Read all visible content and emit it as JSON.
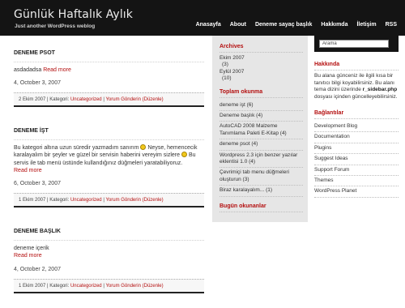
{
  "header": {
    "title": "Günlük Haftalık Aylık",
    "description": "Just another WordPress weblog",
    "nav": [
      "Anasayfa",
      "About",
      "Deneme sayaç başlık",
      "Hakkımda",
      "İletişim",
      "RSS"
    ]
  },
  "posts": [
    {
      "title": "DENEME PSOT",
      "text": "asdadadsa",
      "more": "Read more",
      "date": "4, October 3, 2007",
      "meta_date": "2 Ekim 2007",
      "meta_cat_label": "Kategori:",
      "meta_cat": "Uncategorized",
      "meta_comment": "Yorum Gönderin",
      "meta_edit": "(Düzenle)"
    },
    {
      "title": "DENEME İŞT",
      "text_a": "Bu kategori altına uzun süredir yazmadım sanırım",
      "text_b": "Neyse, hemencecik karalayalım bir şeyler ve güzel bir servisin haberini vereyim sizlere",
      "text_c": "Bu servis ile tab menü üstünde kullandığınız düğmeleri yaratabiliyoruz.",
      "more": "Read more",
      "date": "6, October 3, 2007",
      "meta_date": "1 Ekim 2007",
      "meta_cat_label": "Kategori:",
      "meta_cat": "Uncategorized",
      "meta_comment": "Yorum Gönderin",
      "meta_edit": "(Düzenle)"
    },
    {
      "title": "DENEME BAŞLIK",
      "text": "deneme içerik",
      "more": "Read more",
      "date": "4, October 2, 2007",
      "meta_date": "1 Ekim 2007",
      "meta_cat_label": "Kategori:",
      "meta_cat": "Uncategorized",
      "meta_comment": "Yorum Gönderin",
      "meta_edit": "(Düzenle)"
    }
  ],
  "sidebar_mid": {
    "archives_title": "Archives",
    "archives": [
      {
        "month": "Ekim 2007",
        "count": "(3)"
      },
      {
        "month": "Eylül 2007",
        "count": "(10)"
      }
    ],
    "popular_title": "Toplam okunma",
    "popular": [
      "deneme işt (6)",
      "Deneme başlık (4)",
      "AutoCAD 2008 Malzeme Tanımlama Paleti E-Kitap (4)",
      "deneme psot (4)",
      "Wordpress 2.3 için benzer yazılar eklentisi 1.0 (4)",
      "Çevrimiçi tab menu düğmeleri oluşturun (3)",
      "Biraz karalayalım... (1)"
    ],
    "today_title": "Bugün okunanlar"
  },
  "sidebar_right": {
    "search_value": "Arama",
    "about_title": "Hakkında",
    "about_text_a": "Bu alana günceniz ile ilgili kısa bir tanıtıcı bilgi koyabilirsiniz. Bu alanı tema dizini üzerinde",
    "about_file": "r_sidebar.php",
    "about_text_b": "dosyası içinden güncelleyebilirsiniz.",
    "links_title": "Bağlantılar",
    "links": [
      "Development Blog",
      "Documentation",
      "Plugins",
      "Suggest Ideas",
      "Support Forum",
      "Themes",
      "WordPress Planet"
    ]
  },
  "colors": {
    "header_bg": "#141414",
    "accent_red": "#b40f0f",
    "sidebar_bg": "#e6e6e6"
  }
}
